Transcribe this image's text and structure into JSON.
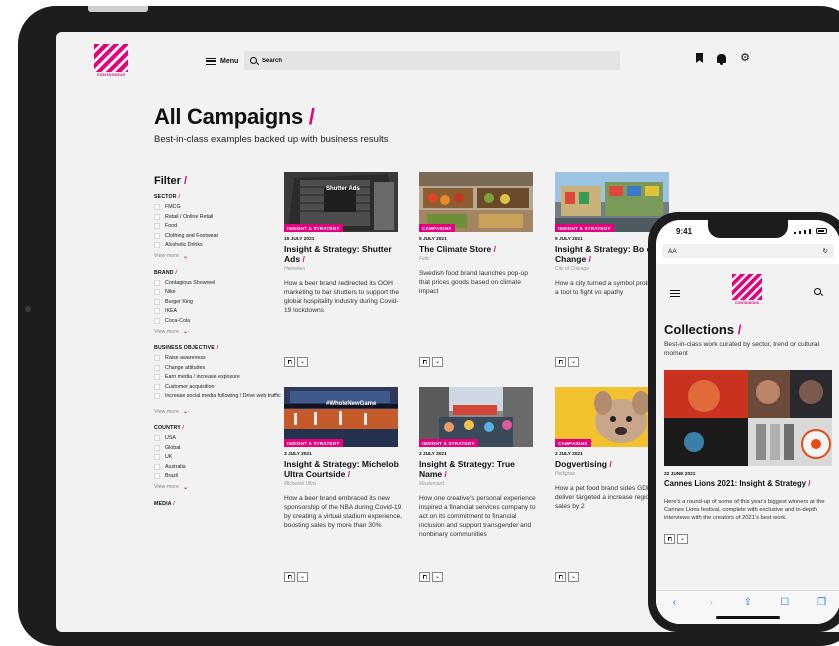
{
  "header": {
    "logo_text": "CONTAGIOUS",
    "menu_label": "Menu",
    "search_placeholder": "Search",
    "icons": [
      "bookmark-icon",
      "bell-icon",
      "gear-icon"
    ]
  },
  "page": {
    "title": "All Campaigns",
    "title_slash": "/",
    "subtitle": "Best-in-class examples backed up with business results"
  },
  "filter": {
    "title": "Filter",
    "groups": [
      {
        "title": "SECTOR",
        "items": [
          "FMCG",
          "Retail / Online Retail",
          "Food",
          "Clothing and Footwear",
          "Alcoholic Drinks"
        ],
        "view_more": "View more"
      },
      {
        "title": "BRAND",
        "items": [
          "Contagious Showreel",
          "Nike",
          "Burger King",
          "IKEA",
          "Coca-Cola"
        ],
        "view_more": "View more"
      },
      {
        "title": "BUSINESS OBJECTIVE",
        "items": [
          "Raise awareness",
          "Change attitudes",
          "Earn media / increase exposure",
          "Customer acquisition",
          "Increase social media following / Drive web traffic"
        ],
        "view_more": "View more"
      },
      {
        "title": "COUNTRY",
        "items": [
          "USA",
          "Global",
          "UK",
          "Australia",
          "Brazil"
        ],
        "view_more": "View more"
      },
      {
        "title": "MEDIA",
        "items": [],
        "view_more": ""
      }
    ]
  },
  "cards": [
    {
      "tag": "INSIGHT & STRATEGY",
      "date": "15 JULY 2021",
      "title": "Insight & Strategy: Shutter Ads",
      "brand": "Heineken",
      "desc": "How a beer brand redirected its OOH marketing to bar shutters to support the global hospitality industry during Covid-19 lockdowns",
      "thumb_text": "Shutter Ads"
    },
    {
      "tag": "CAMPAIGNS",
      "date": "5 JULY 2021",
      "title": "The Climate Store",
      "brand": "Felix",
      "desc": "Swedish food brand launches pop-up that prices goods based on climate impact",
      "thumb_text": ""
    },
    {
      "tag": "INSIGHT & STRATEGY",
      "date": "5 JULY 2021",
      "title": "Insight & Strategy: Bo of Change",
      "brand": "City of Chicago",
      "desc": "How a city turned a symbol protest into a tool to fight vo apathy",
      "thumb_text": ""
    },
    {
      "tag": "INSIGHT & STRATEGY",
      "date": "3 JULY 2021",
      "title": "Insight & Strategy: Michelob Ultra Courtside",
      "brand": "Michelob Ultra",
      "desc": "How a beer brand embraced its new sponsorship of the NBA during Covid-19 by creating a virtual stadium experience, boosting sales by more than 30%",
      "thumb_text": "#WholeNewGame"
    },
    {
      "tag": "INSIGHT & STRATEGY",
      "date": "2 JULY 2021",
      "title": "Insight & Strategy: True Name",
      "brand": "Mastercard",
      "desc": "How one creative's personal experience inspired a financial services company to act on its commitment to financial inclusion and support transgender and nonbinary communities",
      "thumb_text": ""
    },
    {
      "tag": "CAMPAIGNS",
      "date": "2 JULY 2021",
      "title": "Dogvertising",
      "brand": "Pedigree",
      "desc": "How a pet food brand sides GDPR to deliver targeted a increase regional sales by 2",
      "thumb_text": ""
    }
  ],
  "phone": {
    "time": "9:41",
    "address": "AA",
    "logo_text": "CONTAGIOUS",
    "title": "Collections",
    "subtitle": "Best-in-class work curated by sector, trend or cultural moment",
    "date": "22 JUNE 2021",
    "card_title": "Cannes Lions 2021: Insight & Strategy",
    "card_desc": "Here's a round-up of some of this year's biggest winners at the Cannes Lions festival, complete with exclusive and in-depth interviews with the creators of 2021's best work."
  },
  "colors": {
    "accent": "#e6007e",
    "background": "#f2f2f2",
    "device": "#1d1d1f"
  }
}
